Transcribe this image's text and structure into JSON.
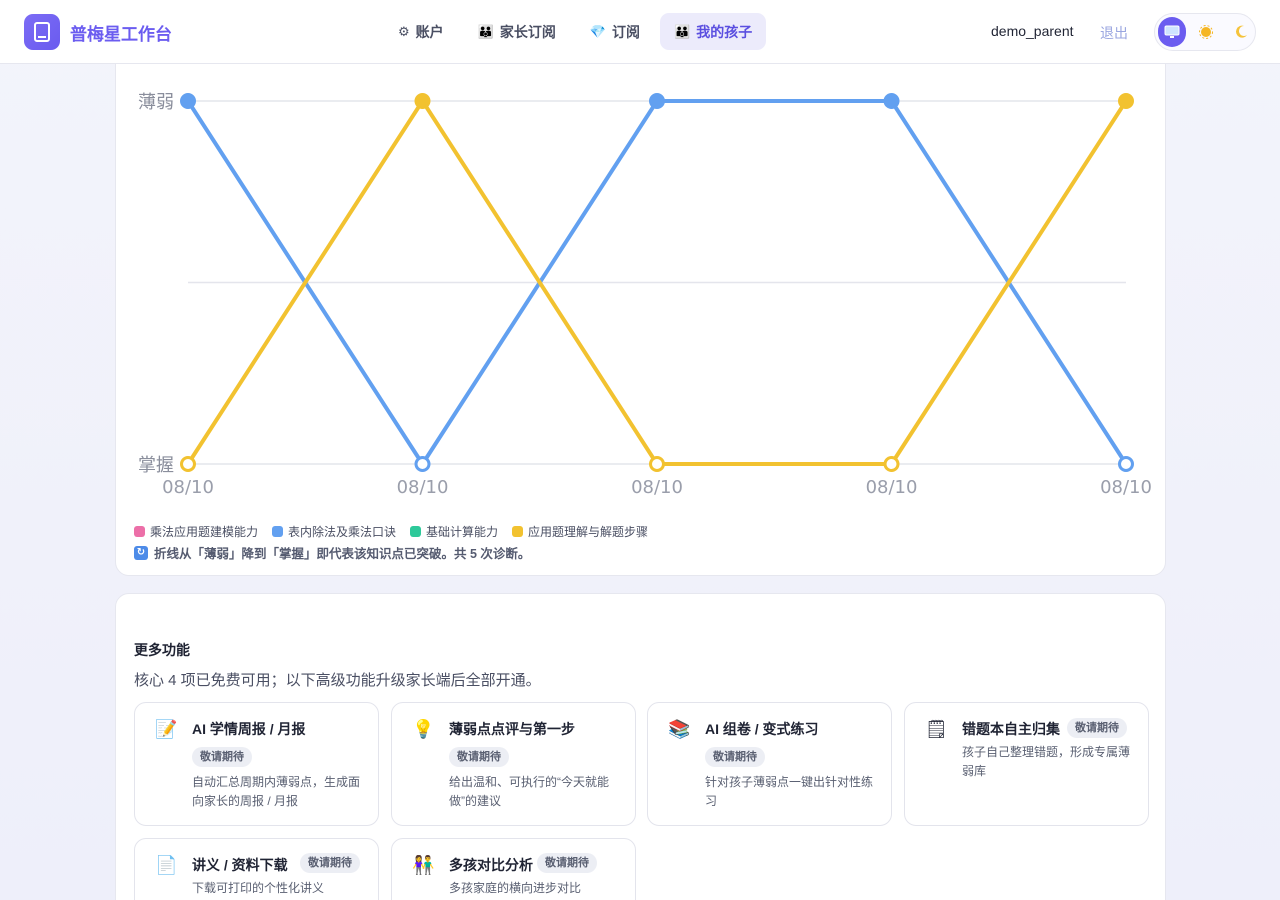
{
  "header": {
    "app_title": "普梅星工作台",
    "logo_icon": "book-icon",
    "nav": [
      {
        "label": "账户",
        "icon": "⚙"
      },
      {
        "label": "家长订阅",
        "icon": "👪"
      },
      {
        "label": "订阅",
        "icon": "💎"
      },
      {
        "label": "我的孩子",
        "icon": "👪",
        "active": true
      }
    ],
    "username": "demo_parent",
    "logout_label": "退出",
    "theme_options": [
      "system",
      "light",
      "dark"
    ],
    "accent_color": "#6b5cf0"
  },
  "chart_data": {
    "type": "line",
    "y_categories": [
      "掌握",
      "薄弱"
    ],
    "x": [
      "08/10",
      "08/10",
      "08/10",
      "08/10",
      "08/10"
    ],
    "series": [
      {
        "name": "表内除法及乘法口诀",
        "color": "#62a0f0",
        "values": [
          1,
          0,
          1,
          1,
          0
        ]
      },
      {
        "name": "应用题理解与解题步骤",
        "color": "#f2c230",
        "values": [
          0,
          1,
          0,
          0,
          1
        ]
      }
    ],
    "legend": [
      {
        "name": "乘法应用题建模能力",
        "color": "#ec6fa8"
      },
      {
        "name": "表内除法及乘法口诀",
        "color": "#62a0f0"
      },
      {
        "name": "基础计算能力",
        "color": "#2ec99a"
      },
      {
        "name": "应用题理解与解题步骤",
        "color": "#f2c230"
      }
    ],
    "grid": true
  },
  "chart_note": "折线从「薄弱」降到「掌握」即代表该知识点已突破。共 5 次诊断。",
  "more": {
    "title": "更多功能",
    "subtitle": "核心 4 项已免费可用；以下高级功能升级家长端后全部开通。",
    "features": [
      {
        "title": "AI 学情周报 / 月报",
        "badge": "敬请期待",
        "desc": "自动汇总周期内薄弱点，生成面向家长的周报 / 月报",
        "icon": "📝"
      },
      {
        "title": "薄弱点点评与第一步",
        "badge": "敬请期待",
        "desc": "给出温和、可执行的“今天就能做”的建议",
        "icon": "💡"
      },
      {
        "title": "AI 组卷 / 变式练习",
        "badge": "敬请期待",
        "desc": "针对孩子薄弱点一键出针对性练习",
        "icon": "📚"
      },
      {
        "title": "错题本自主归集",
        "badge": "敬请期待",
        "desc": "孩子自己整理错题，形成专属薄弱库",
        "icon": "🗒"
      },
      {
        "title": "讲义 / 资料下载",
        "badge": "敬请期待",
        "desc": "下载可打印的个性化讲义",
        "icon": "📄"
      },
      {
        "title": "多孩对比分析",
        "badge": "敬请期待",
        "desc": "多孩家庭的横向进步对比",
        "icon": "👫"
      }
    ]
  }
}
